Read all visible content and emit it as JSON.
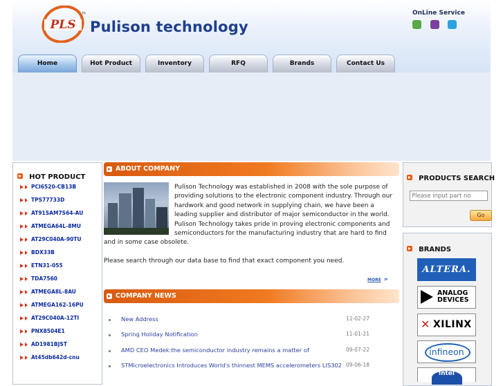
{
  "header": {
    "logo_mark": "PLS",
    "company_name": "Pulison technology",
    "online_service_label": "OnLine Service",
    "im_icons": [
      "msn-icon",
      "yahoo-icon",
      "skype-icon"
    ]
  },
  "nav": {
    "tabs": [
      {
        "label": "Home",
        "active": true
      },
      {
        "label": "Hot Product",
        "active": false
      },
      {
        "label": "Inventory",
        "active": false
      },
      {
        "label": "RFQ",
        "active": false
      },
      {
        "label": "Brands",
        "active": false
      },
      {
        "label": "Contact Us",
        "active": false
      }
    ]
  },
  "hot_product": {
    "title": "HOT PRODUCT",
    "items": [
      "PCI6520-CB13B",
      "TPS77733D",
      "AT91SAM7S64-AU",
      "ATMEGA64L-8MU",
      "AT29C040A-90TU",
      "BDX33B",
      "ETN31-055",
      "TDA7560",
      "ATMEGA8L-8AU",
      "ATMEGA162-16PU",
      "AT29C040A-12TI",
      "PNX8504E1",
      "AD1981BJST",
      "At45db642d-cnu"
    ]
  },
  "about": {
    "title": "ABOUT COMPANY",
    "paragraph": "Pulison Technology was established in 2008 with the sole purpose of providing solutions to the electronic component industry. Through our hardwork and good network in supplying chain, we have been a leading supplier and distributor of major semiconductor in the world. Pulison Technology takes pride in proving electronic components and semiconductors for the manufacturing industry that are hard to find and in some case obsolete.",
    "paragraph2": "Please search through our data base to find that exact component you need.",
    "more_label": "MORE"
  },
  "news": {
    "title": "COMPANY NEWS",
    "items": [
      {
        "title": "New Address",
        "date": "11-02-27"
      },
      {
        "title": "Spring Holiday Notification",
        "date": "11-01-21"
      },
      {
        "title": "AMD CEO Medek:the semiconductor industry remains a matter of",
        "date": "09-07-22"
      },
      {
        "title": "STMicroelectronics Introduces World's thinnest MEMS accelerometers LIS302",
        "date": "09-06-18"
      }
    ]
  },
  "search": {
    "title": "PRODUCTS SEARCH",
    "placeholder": "Please input part no",
    "button_label": "Go"
  },
  "brands": {
    "title": "BRANDS",
    "logos": [
      "ALTERA.",
      "ANALOG DEVICES",
      "XILINX",
      "infineon",
      "intel"
    ]
  },
  "colors": {
    "accent_orange": "#e75b12",
    "link_blue": "#0a2a9e",
    "logo_blue": "#1f3f8c"
  }
}
